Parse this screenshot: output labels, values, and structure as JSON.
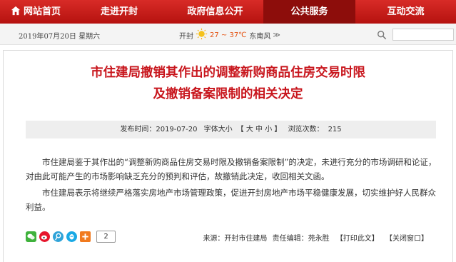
{
  "nav": {
    "items": [
      {
        "label": "网站首页"
      },
      {
        "label": "走进开封"
      },
      {
        "label": "政府信息公开"
      },
      {
        "label": "公共服务"
      },
      {
        "label": "互动交流"
      }
    ],
    "active_index": 3
  },
  "infobar": {
    "date": "2019年07月20日 星期六",
    "city": "开封",
    "temp": "27 ~ 37℃",
    "wind": "东南风",
    "more": "≫"
  },
  "article": {
    "title_line1": "市住建局撤销其作出的调整新购商品住房交易时限",
    "title_line2": "及撤销备案限制的相关决定",
    "meta": {
      "publish_label": "发布时间：",
      "publish_date": "2019-07-20",
      "font_size_label": "字体大小",
      "font_size_options": "【 大 中 小 】",
      "views_label": "浏览次数：",
      "views": "215"
    },
    "paragraphs": [
      "市住建局鉴于其作出的“调整新购商品住房交易时限及撤销备案限制”的决定，未进行充分的市场调研和论证，对由此可能产生的市场影响缺乏充分的预判和评估，故撤销此决定，收回相关文函。",
      "市住建局表示将继续严格落实房地产市场管理政策，促进开封房地产市场平稳健康发展，切实维护好人民群众利益。"
    ],
    "share_count": "2",
    "footer": {
      "source": "来源：开封市住建局",
      "editor": "责任编辑：苑永胜",
      "print": "【打印此文】",
      "close": "【关闭窗口】"
    }
  },
  "colors": {
    "nav_red": "#c8161d",
    "title_red": "#c8161d",
    "temp_orange": "#e4500e"
  }
}
